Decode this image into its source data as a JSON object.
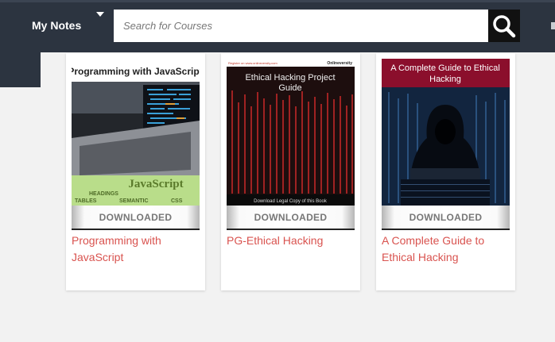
{
  "header": {
    "menu_label": "My Notes",
    "search_placeholder": "Search for Courses",
    "search_icon": "search-icon"
  },
  "courses": [
    {
      "cover_title": "Programming with JavaScript",
      "cover_text": "JavaScript",
      "cover_words": [
        "HEADINGS",
        "TABLES",
        "SEMANTIC",
        "CSS"
      ],
      "status": "DOWNLOADED",
      "title": "Programming with JavaScript"
    },
    {
      "cover_top_left": "Register on www.onlineversity.com",
      "cover_top_right": "Onlineversity",
      "cover_title": "Ethical Hacking Project Guide",
      "cover_footer": "Download Legal Copy of this Book",
      "status": "DOWNLOADED",
      "title": "PG-Ethical Hacking"
    },
    {
      "cover_title": "A Complete Guide to Ethical Hacking",
      "status": "DOWNLOADED",
      "title": "A Complete Guide to Ethical Hacking"
    }
  ]
}
